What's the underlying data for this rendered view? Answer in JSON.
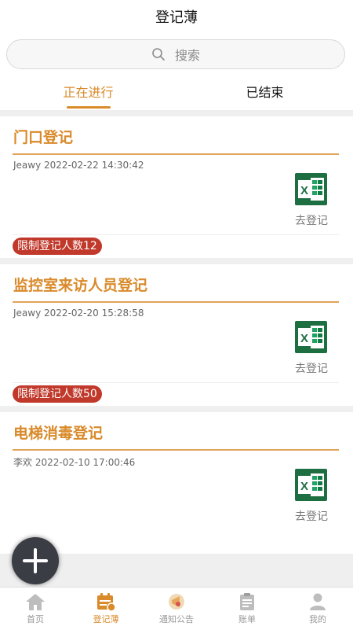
{
  "header": {
    "title": "登记薄"
  },
  "search": {
    "placeholder": "搜索"
  },
  "tabs": [
    {
      "label": "正在进行",
      "active": true
    },
    {
      "label": "已结束",
      "active": false
    }
  ],
  "cards": [
    {
      "title": "门口登记",
      "author": "Jeawy",
      "timestamp": "2022-02-22 14:30:42",
      "action": "去登记",
      "limit": "限制登记人数12"
    },
    {
      "title": "监控室来访人员登记",
      "author": "Jeawy",
      "timestamp": "2022-02-20 15:28:58",
      "action": "去登记",
      "limit": "限制登记人数50"
    },
    {
      "title": "电梯消毒登记",
      "author": "李欢",
      "timestamp": "2022-02-10 17:00:46",
      "action": "去登记"
    }
  ],
  "tabbar": [
    {
      "label": "首页",
      "icon": "home-icon",
      "active": false
    },
    {
      "label": "登记薄",
      "icon": "register-icon",
      "active": true
    },
    {
      "label": "通知公告",
      "icon": "notice-icon",
      "active": false
    },
    {
      "label": "账单",
      "icon": "bill-icon",
      "active": false
    },
    {
      "label": "我的",
      "icon": "profile-icon",
      "active": false
    }
  ],
  "colors": {
    "accent": "#d98a2a",
    "badge": "#c0392b",
    "excel": "#1d6f42"
  }
}
